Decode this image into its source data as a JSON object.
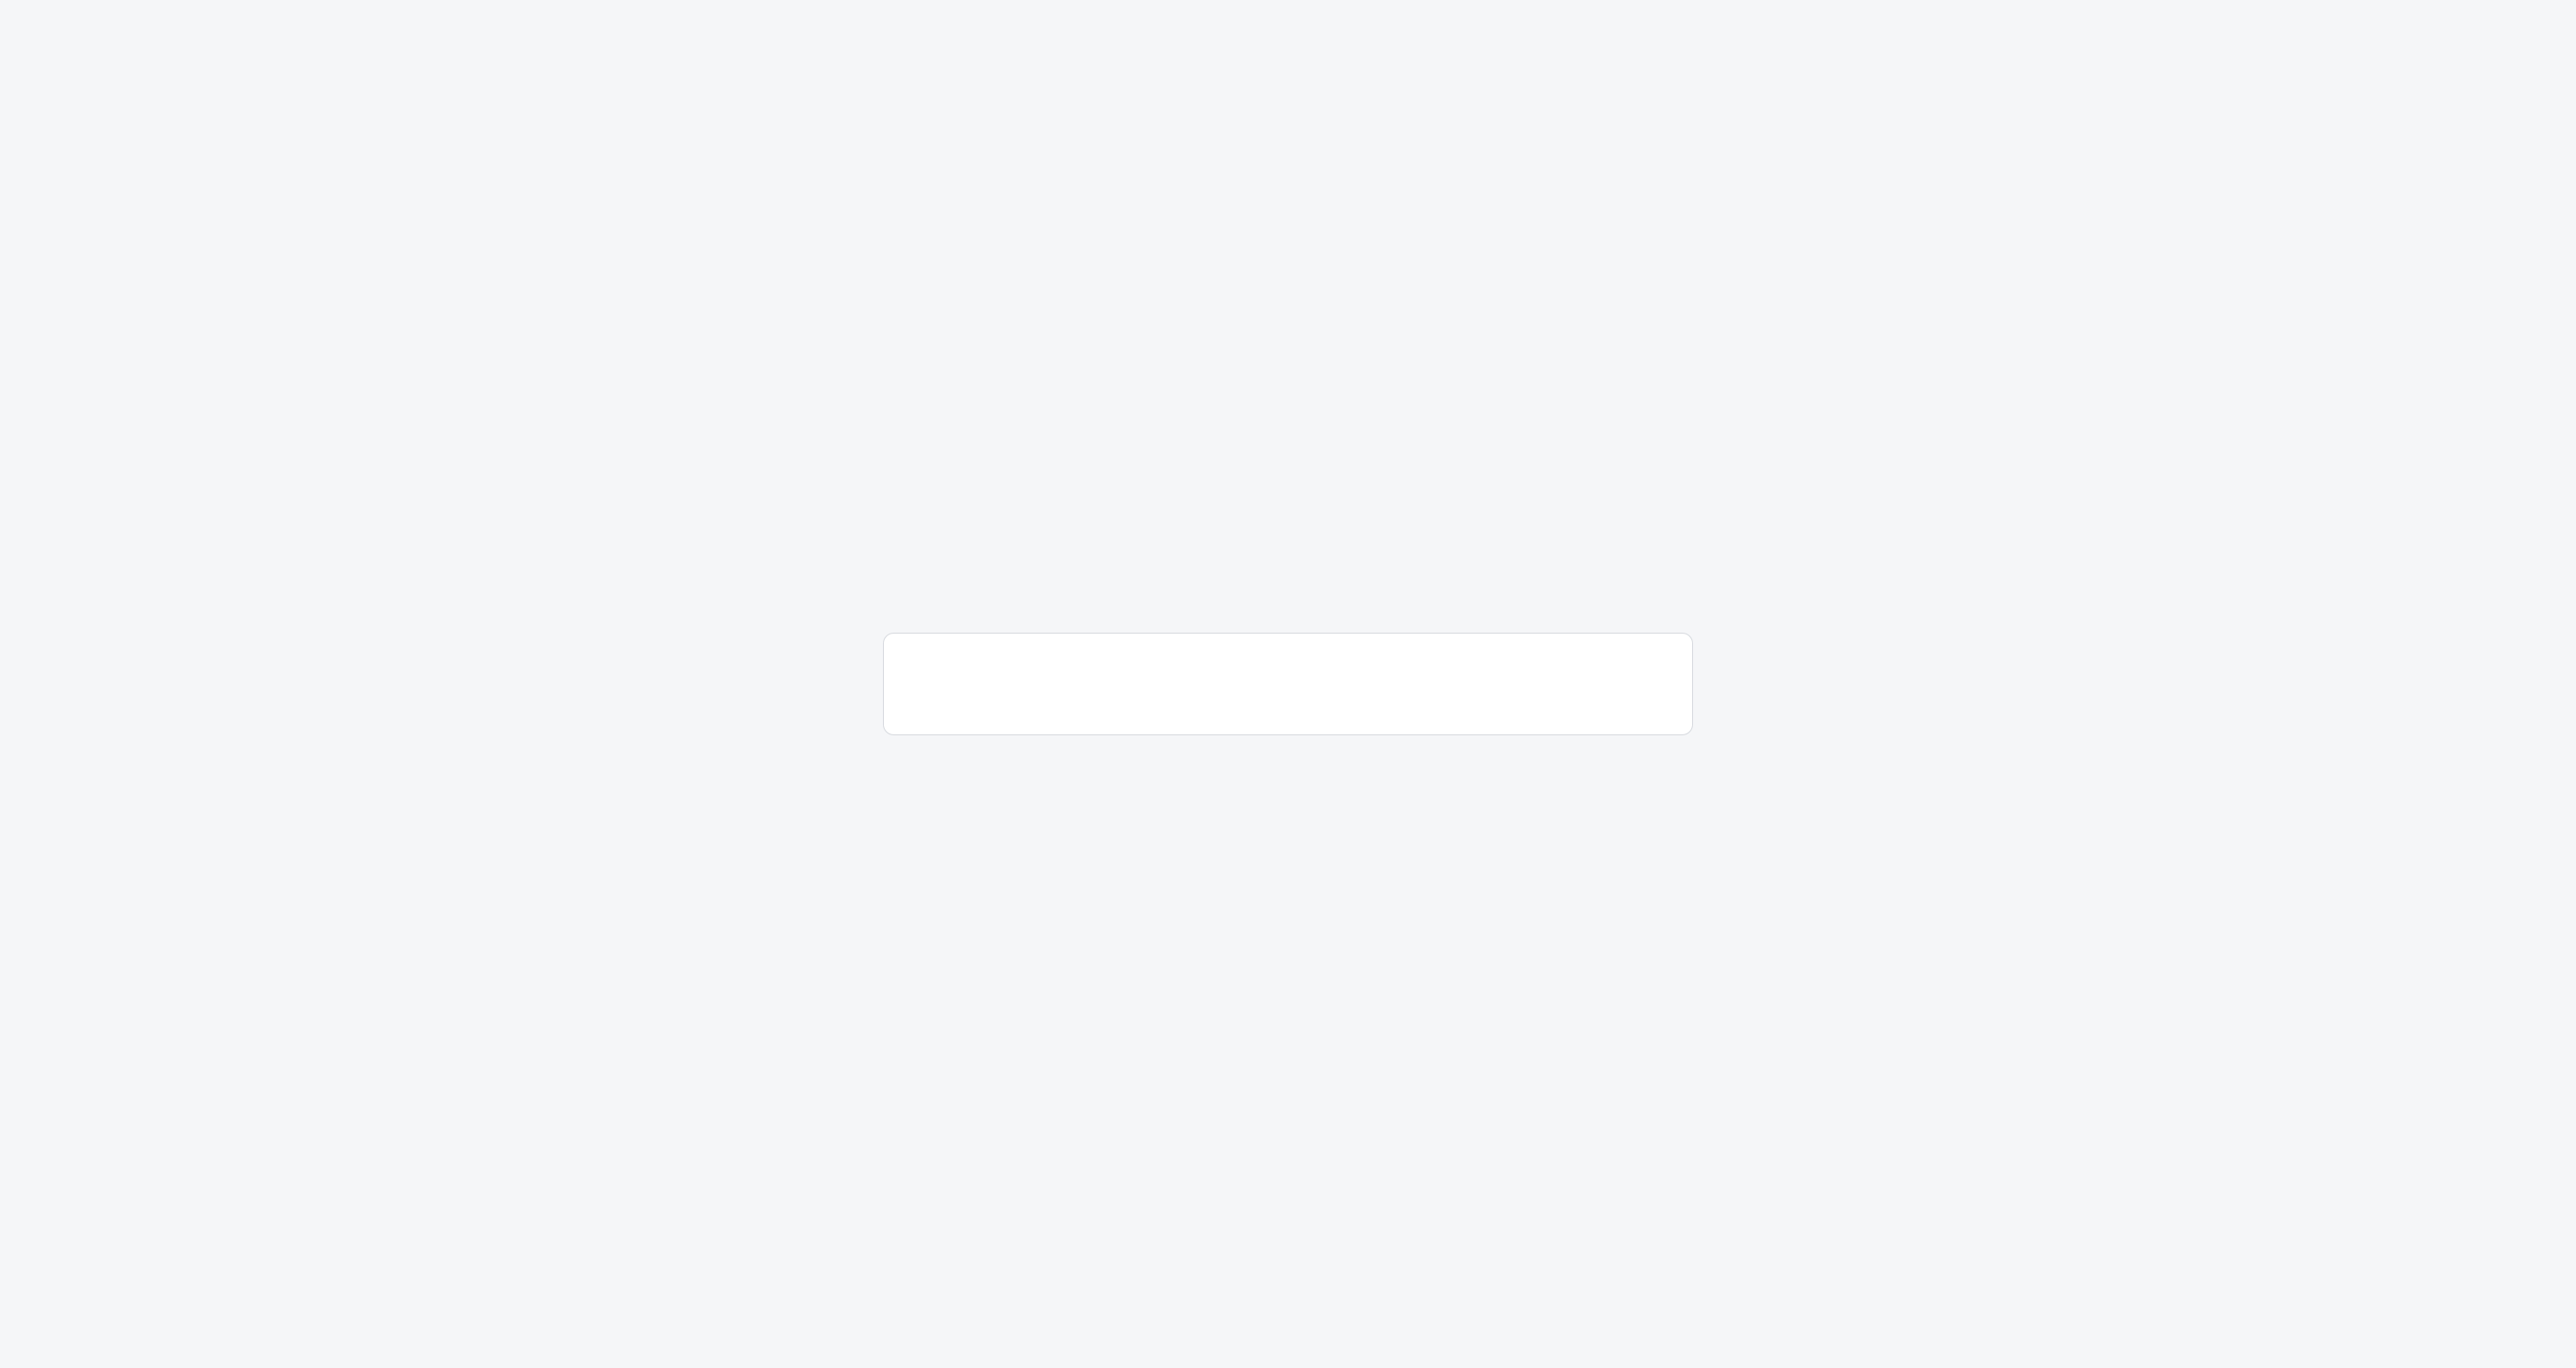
{
  "notice": {
    "title": "",
    "body": ""
  }
}
